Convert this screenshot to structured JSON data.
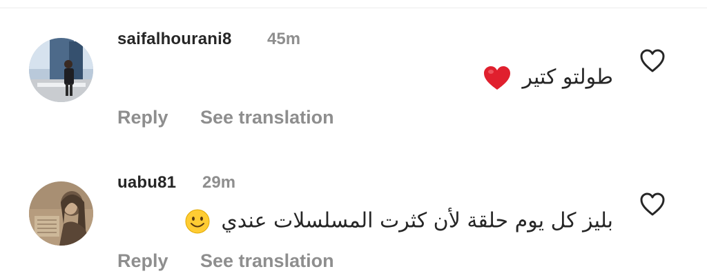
{
  "comments": [
    {
      "username": "saifalhourani8",
      "time": "45m",
      "text": "طولتو كتير",
      "emoji": "red-heart",
      "reply_label": "Reply",
      "translate_label": "See translation"
    },
    {
      "username": "uabu81",
      "time": "29m",
      "text": "بليز كل يوم حلقة لأن كثرت المسلسلات عندي",
      "emoji": "smiling-face",
      "reply_label": "Reply",
      "translate_label": "See translation"
    }
  ],
  "colors": {
    "text": "#262626",
    "secondary": "#8e8e8e",
    "heart": "#e0202e"
  }
}
